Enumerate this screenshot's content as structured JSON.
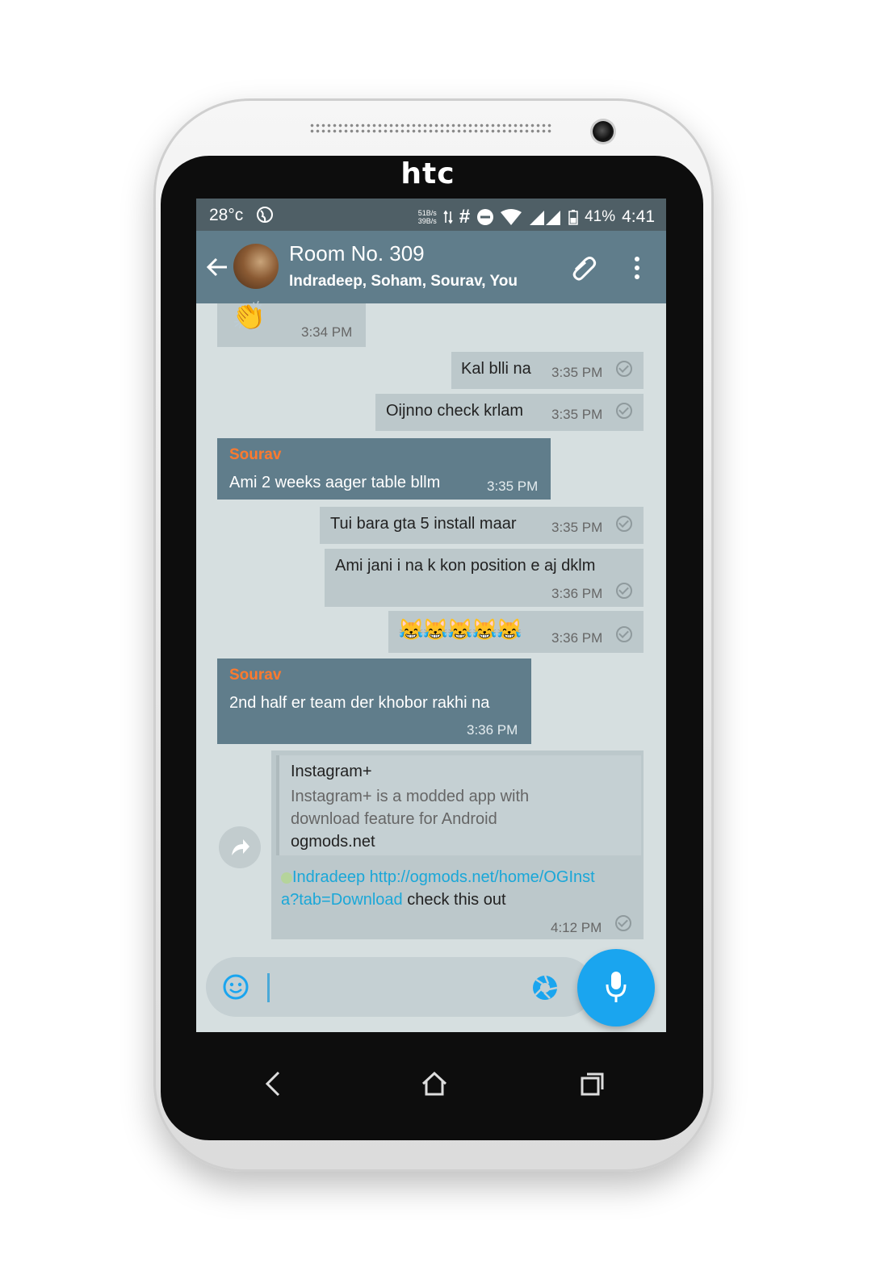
{
  "device": {
    "brand": "htc"
  },
  "status_bar": {
    "temperature": "28°c",
    "net_up": "51B/s",
    "net_down": "39B/s",
    "hash": "#",
    "battery": "41%",
    "time": "4:41"
  },
  "toolbar": {
    "title": "Room No. 309",
    "subtitle": "Indradeep, Soham, Sourav, You"
  },
  "messages": {
    "m0": {
      "emoji": "👏",
      "time": "3:34 PM"
    },
    "m1": {
      "text": "Kal blli na",
      "time": "3:35 PM"
    },
    "m2": {
      "text": "Oijnno check krlam",
      "time": "3:35 PM"
    },
    "m3": {
      "sender": "Sourav",
      "text": "Ami 2 weeks aager table bllm",
      "time": "3:35 PM"
    },
    "m4": {
      "text": "Tui bara gta 5 install maar",
      "time": "3:35 PM"
    },
    "m5": {
      "text": "Ami jani i na k kon position e aj dklm",
      "time": "3:36 PM"
    },
    "m6": {
      "emoji": "😹😹😹😹😹",
      "time": "3:36 PM"
    },
    "m7": {
      "sender": "Sourav",
      "text": "2nd half er team der khobor rakhi na",
      "time": "3:36 PM"
    },
    "m8": {
      "preview_title": "Instagram+",
      "preview_desc": "Instagram+ is a modded app with download feature for Android",
      "preview_site": "ogmods.net",
      "mention": "Indradeep",
      "url": "http://ogmods.net/home/OGInsta?tab=Download",
      "trailing_text": "check this out",
      "time": "4:12 PM"
    }
  },
  "colors": {
    "status_bar": "#4f5f66",
    "toolbar": "#607d8b",
    "chat_bg": "#d6dfe0",
    "outgoing_bubble": "#bcc8cb",
    "incoming_bubble": "#607d8b",
    "sender_name": "#ff7a2e",
    "link": "#1aa7d8",
    "mic_button": "#1aa5ef"
  },
  "icons": {
    "back": "arrow-left-icon",
    "attach": "paperclip-icon",
    "menu": "more-vert-icon",
    "share": "share-icon",
    "emoji": "smiley-icon",
    "camera": "camera-shutter-icon",
    "mic": "mic-icon"
  }
}
